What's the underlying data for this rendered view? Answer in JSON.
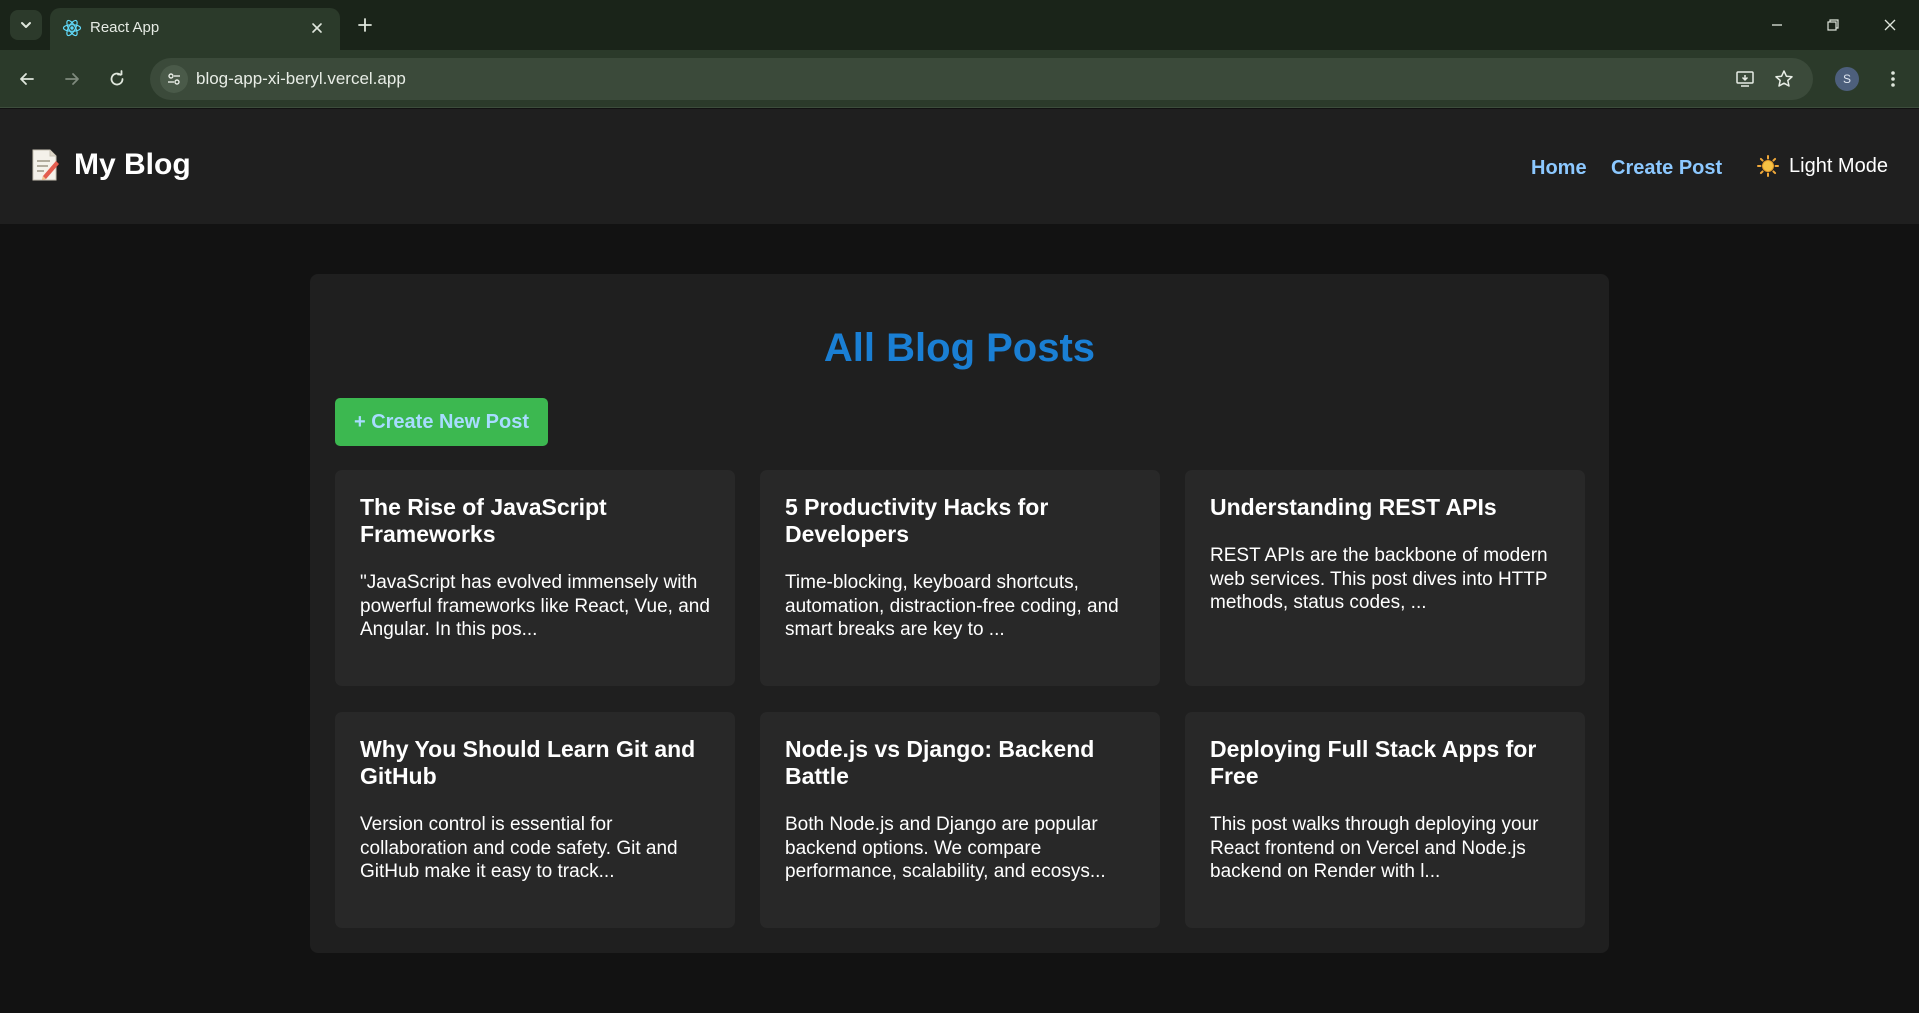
{
  "browser": {
    "tab_title": "React App",
    "url": "blog-app-xi-beryl.vercel.app",
    "profile_initial": "S"
  },
  "header": {
    "brand_emoji": "memo-icon",
    "brand_title": "My Blog",
    "nav": {
      "home": "Home",
      "create_post": "Create Post"
    },
    "theme_toggle": {
      "icon": "sun-icon",
      "label": "Light Mode"
    }
  },
  "main": {
    "title": "All Blog Posts",
    "create_button": "+ Create New Post",
    "posts": [
      {
        "title": "The Rise of JavaScript Frameworks",
        "excerpt": "\"JavaScript has evolved immensely with powerful frameworks like React, Vue, and Angular. In this pos..."
      },
      {
        "title": "5 Productivity Hacks for Developers",
        "excerpt": "Time-blocking, keyboard shortcuts, automation, distraction-free coding, and smart breaks are key to ..."
      },
      {
        "title": "Understanding REST APIs",
        "excerpt": "REST APIs are the backbone of modern web services. This post dives into HTTP methods, status codes, ..."
      },
      {
        "title": "Why You Should Learn Git and GitHub",
        "excerpt": "Version control is essential for collaboration and code safety. Git and GitHub make it easy to track..."
      },
      {
        "title": "Node.js vs Django: Backend Battle",
        "excerpt": "Both Node.js and Django are popular backend options. We compare performance, scalability, and ecosys..."
      },
      {
        "title": "Deploying Full Stack Apps for Free",
        "excerpt": "This post walks through deploying your React frontend on Vercel and Node.js backend on Render with l..."
      }
    ]
  },
  "colors": {
    "page_bg": "#121212",
    "header_bg": "#1f1f1f",
    "card_bg": "#282828",
    "title_blue": "#1a7fd4",
    "nav_link": "#8cc8ff",
    "button_green": "#3cb850"
  }
}
